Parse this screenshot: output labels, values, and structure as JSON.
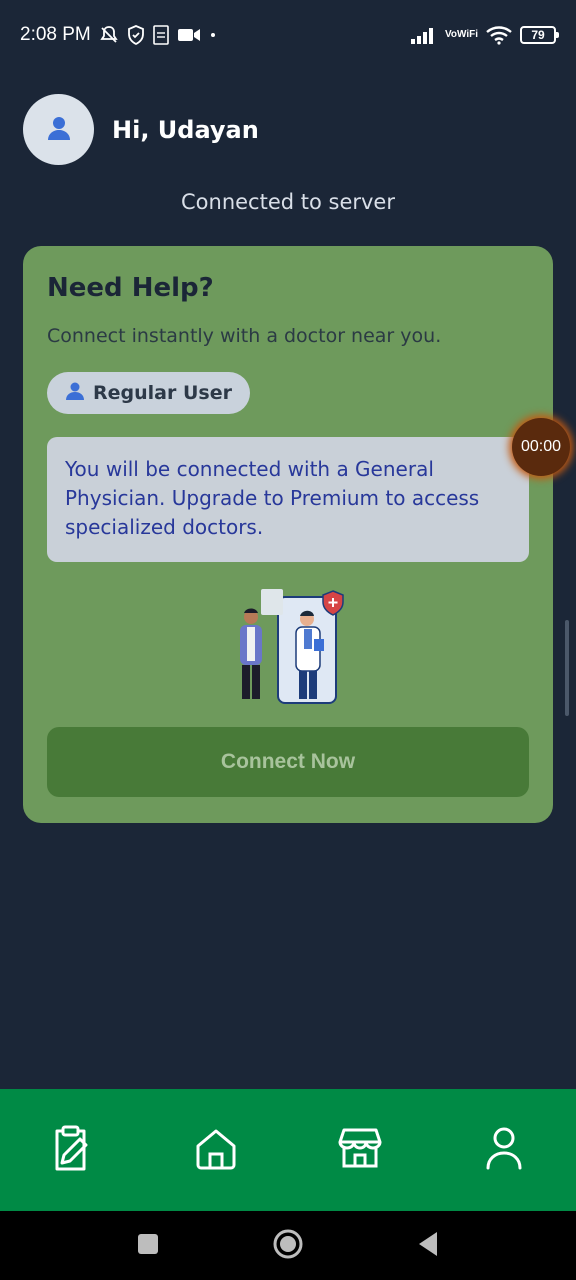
{
  "status_bar": {
    "time": "2:08 PM",
    "left_icons": [
      "mute-icon",
      "shield-icon",
      "pdf-icon",
      "video-icon",
      "dot-icon"
    ],
    "right_icons": [
      "signal-icon",
      "vowifi-icon",
      "wifi-icon",
      "battery-icon"
    ],
    "vowifi_label_top": "Vo",
    "vowifi_label_bottom": "WiFi",
    "battery_level": "79"
  },
  "header": {
    "avatar_icon": "user-icon",
    "greeting": "Hi, Udayan"
  },
  "connection_status": "Connected to server",
  "help_card": {
    "title": "Need Help?",
    "subtitle": "Connect instantly with a doctor near you.",
    "user_chip_icon": "user-icon",
    "user_chip_label": "Regular User",
    "info_text": "You will be connected with a General Physician. Upgrade to Premium to access specialized doctors.",
    "illustration": "doctor-consultation-illustration",
    "connect_button_label": "Connect Now"
  },
  "call_timer": "00:00",
  "bottom_nav": {
    "items": [
      {
        "icon": "clipboard-edit-icon"
      },
      {
        "icon": "home-icon"
      },
      {
        "icon": "store-icon"
      },
      {
        "icon": "profile-icon"
      }
    ]
  },
  "colors": {
    "background": "#1b2637",
    "card": "#6e9a5c",
    "button": "#487a38",
    "nav": "#008a45",
    "info_text": "#28389a"
  }
}
